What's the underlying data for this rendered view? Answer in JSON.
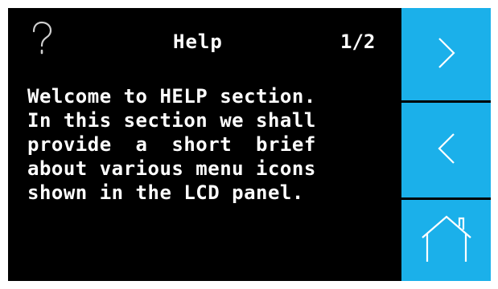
{
  "header": {
    "help_icon": "question-mark-icon",
    "title": "Help",
    "page_indicator": "1/2"
  },
  "content": {
    "lines": [
      "Welcome to HELP section.",
      "In this section we shall",
      "provide  a  short  brief",
      "about various menu icons",
      "shown in the LCD panel."
    ]
  },
  "side_buttons": {
    "next_icon": "chevron-right-icon",
    "previous_icon": "chevron-left-icon",
    "home_icon": "home-icon"
  },
  "colors": {
    "screen_background": "#000000",
    "text": "#ffffff",
    "button_background": "#1bb0ea",
    "button_icon": "#ffffff",
    "help_icon": "#cfcfcf"
  }
}
